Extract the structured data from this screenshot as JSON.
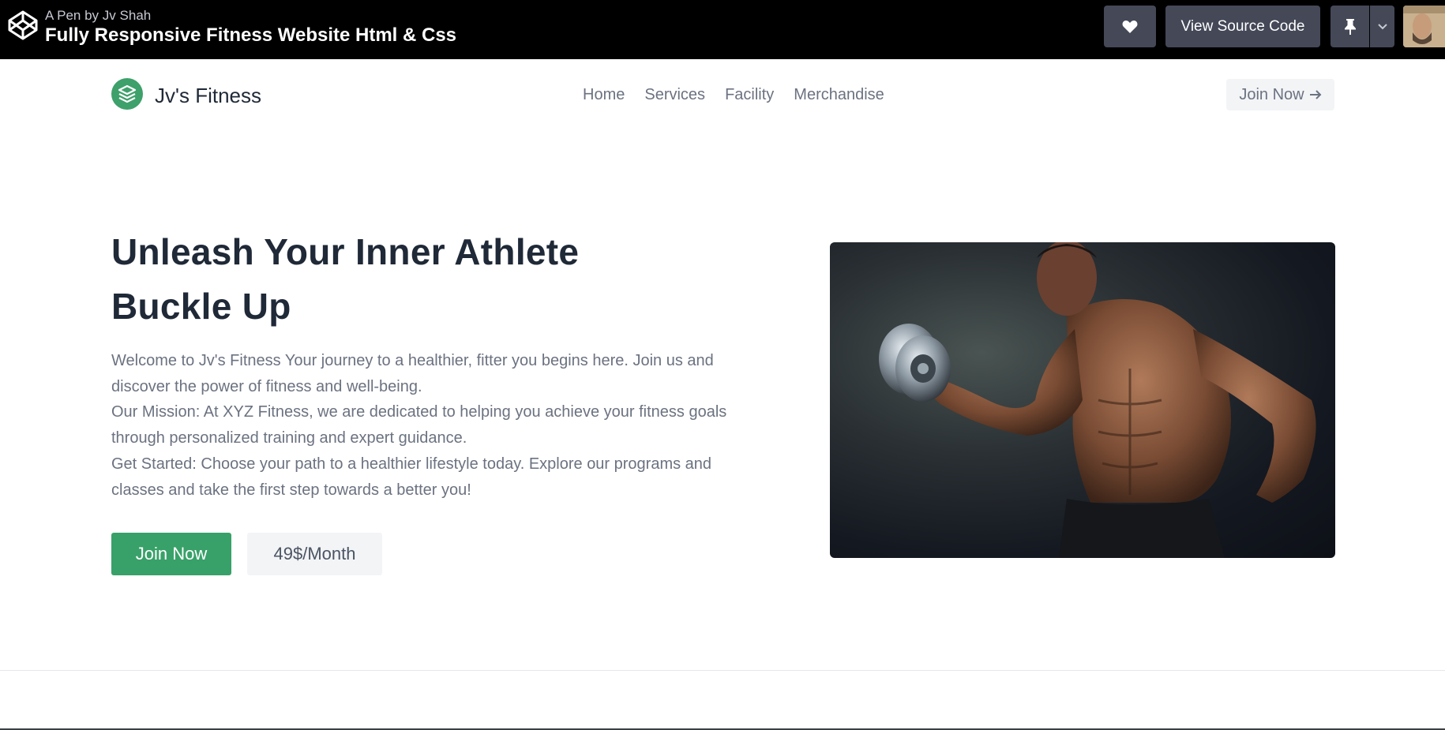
{
  "codepen": {
    "byline_prefix": "A Pen by",
    "author": "Jv Shah",
    "title": "Fully Responsive Fitness Website Html & Css",
    "view_source_label": "View Source Code"
  },
  "site": {
    "brand": "Jv's Fitness",
    "nav": [
      "Home",
      "Services",
      "Facility",
      "Merchandise"
    ],
    "join_label": "Join Now",
    "accent_color": "#38a169"
  },
  "hero": {
    "title_line1": "Unleash Your Inner Athlete",
    "title_line2": "Buckle Up",
    "para1": "Welcome to Jv's Fitness Your journey to a healthier, fitter you begins here. Join us and discover the power of fitness and well-being.",
    "para2": "Our Mission: At XYZ Fitness, we are dedicated to helping you achieve your fitness goals through personalized training and expert guidance.",
    "para3": "Get Started: Choose your path to a healthier lifestyle today. Explore our programs and classes and take the first step towards a better you!",
    "cta_join": "Join Now",
    "cta_price": "49$/Month"
  }
}
